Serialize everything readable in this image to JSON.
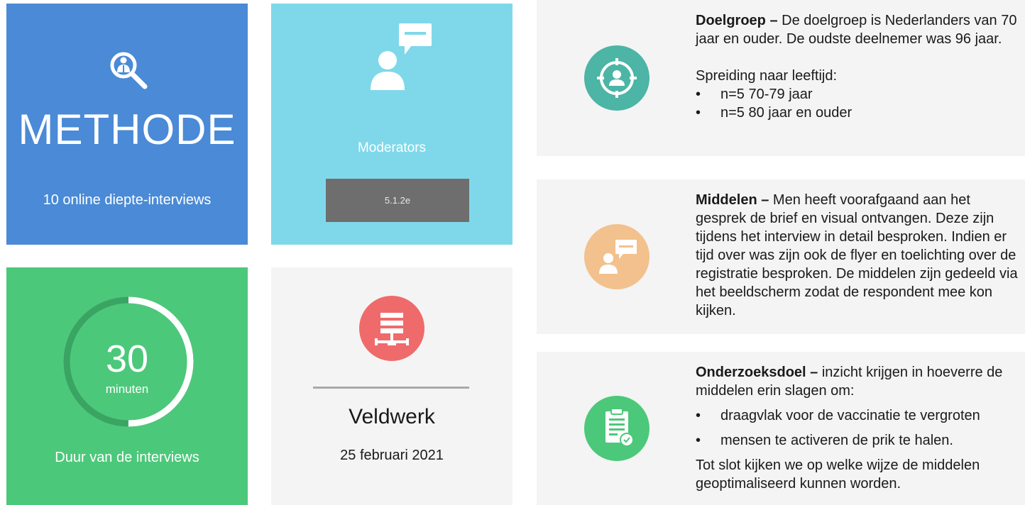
{
  "methode": {
    "title": "METHODE",
    "subtitle": "10 online diepte-interviews",
    "icon": "search-person-icon"
  },
  "moderators": {
    "label": "Moderators",
    "redacted_code": "5.1.2e",
    "icon": "speaker-chat-icon"
  },
  "duur": {
    "value": "30",
    "unit": "minuten",
    "label": "Duur van de interviews",
    "progress_fraction": 0.5,
    "icon": "progress-ring"
  },
  "veldwerk": {
    "title": "Veldwerk",
    "date": "25 februari 2021",
    "icon": "network-server-icon"
  },
  "doelgroep": {
    "heading": "Doelgroep –",
    "text": " De doelgroep is Nederlanders van 70 jaar en ouder. De oudste deelnemer was 96 jaar.",
    "spreiding_title": "Spreiding naar leeftijd:",
    "bullets": [
      "n=5 70-79 jaar",
      "n=5 80 jaar en ouder"
    ],
    "icon": "target-person-icon",
    "color": "#4cb5a5"
  },
  "middelen": {
    "heading": "Middelen –",
    "text": " Men heeft voorafgaand aan het gesprek de brief en visual ontvangen. Deze zijn tijdens het interview in detail besproken. Indien er tijd over was zijn ook de flyer en toelichting over de registratie besproken. De middelen zijn gedeeld via het beeldscherm zodat de respondent mee kon kijken.",
    "icon": "person-chat-icon",
    "color": "#f2c18d"
  },
  "onderzoeksdoel": {
    "heading": "Onderzoeksdoel –",
    "text": " inzicht krijgen in hoeverre de middelen erin slagen om:",
    "bullets": [
      "draagvlak voor de vaccinatie te vergroten",
      "mensen te activeren de prik te halen."
    ],
    "closing": "Tot slot kijken we op welke wijze de middelen geoptimaliseerd kunnen worden.",
    "icon": "clipboard-check-icon",
    "color": "#4cc87a"
  }
}
